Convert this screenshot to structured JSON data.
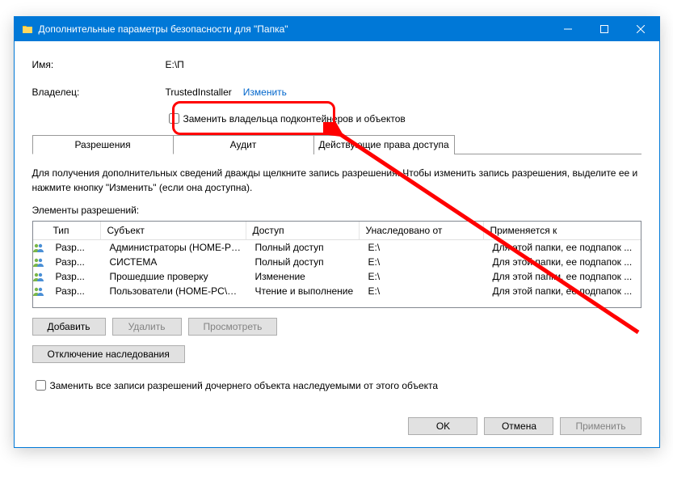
{
  "titlebar": {
    "title": "Дополнительные параметры безопасности для \"Папка\""
  },
  "fields": {
    "name_label": "Имя:",
    "name_value": "E:\\П",
    "owner_label": "Владелец:",
    "owner_value": "TrustedInstaller",
    "change_link": "Изменить",
    "replace_owner": "Заменить владельца подконтейнеров и объектов"
  },
  "tabs": {
    "permissions": "Разрешения",
    "audit": "Аудит",
    "effective": "Действующие права доступа"
  },
  "hint": "Для получения дополнительных сведений дважды щелкните запись разрешения. Чтобы изменить запись разрешения, выделите ее и нажмите кнопку \"Изменить\" (если она доступна).",
  "section_label": "Элементы разрешений:",
  "table": {
    "headers": {
      "type": "Тип",
      "subject": "Субъект",
      "access": "Доступ",
      "inherited": "Унаследовано от",
      "applies": "Применяется к"
    },
    "rows": [
      {
        "type": "Разр...",
        "subject": "Администраторы (HOME-PC...",
        "access": "Полный доступ",
        "inherited": "E:\\",
        "applies": "Для этой папки, ее подпапок ..."
      },
      {
        "type": "Разр...",
        "subject": "СИСТЕМА",
        "access": "Полный доступ",
        "inherited": "E:\\",
        "applies": "Для этой папки, ее подпапок ..."
      },
      {
        "type": "Разр...",
        "subject": "Прошедшие проверку",
        "access": "Изменение",
        "inherited": "E:\\",
        "applies": "Для этой папки, ее подпапок ..."
      },
      {
        "type": "Разр...",
        "subject": "Пользователи (HOME-PC\\П...",
        "access": "Чтение и выполнение",
        "inherited": "E:\\",
        "applies": "Для этой папки, ее подпапок ..."
      }
    ]
  },
  "buttons": {
    "add": "Добавить",
    "remove": "Удалить",
    "view": "Просмотреть",
    "disable_inherit": "Отключение наследования",
    "replace_child": "Заменить все записи разрешений дочернего объекта наследуемыми от этого объекта",
    "ok": "OK",
    "cancel": "Отмена",
    "apply": "Применить"
  }
}
